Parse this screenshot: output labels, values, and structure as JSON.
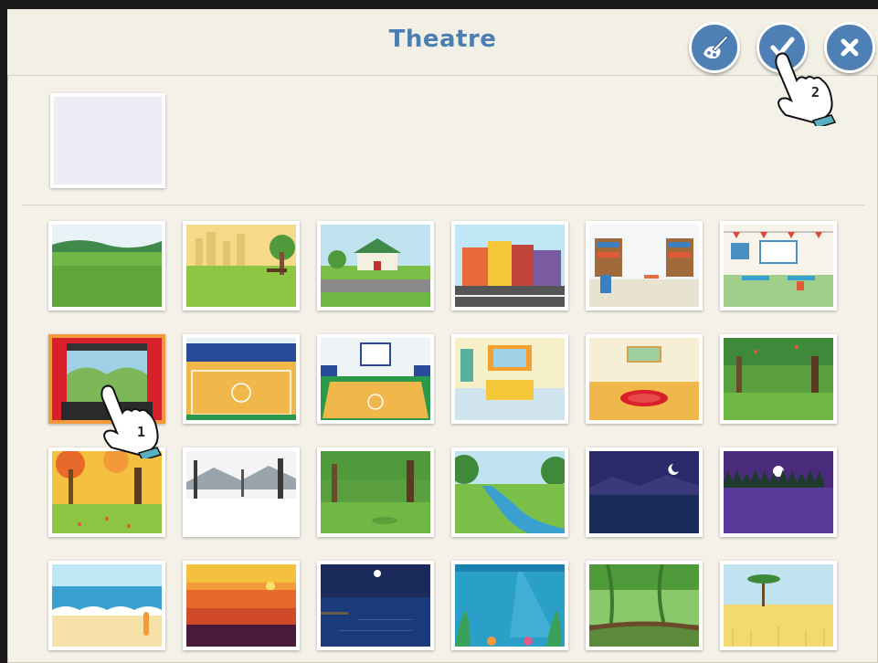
{
  "header": {
    "title": "Theatre",
    "buttons": [
      {
        "name": "paint-button",
        "icon": "paintbrush-icon"
      },
      {
        "name": "confirm-button",
        "icon": "checkmark-icon"
      },
      {
        "name": "close-button",
        "icon": "close-icon"
      }
    ]
  },
  "colors": {
    "accent": "#4f80b5",
    "selected_border": "#f29a3a",
    "background": "#f4f1e8"
  },
  "selected_slot": {
    "state": "empty"
  },
  "library": {
    "items": [
      "meadow",
      "city-park",
      "suburb",
      "city-street",
      "library",
      "classroom",
      "theatre",
      "gym",
      "basketball-court",
      "bedroom",
      "empty-room",
      "orchard",
      "autumn-forest",
      "winter-forest",
      "forest",
      "river",
      "night-lake",
      "night-forest",
      "beach",
      "sunset-sea",
      "night-pier",
      "underwater",
      "jungle",
      "savanna"
    ],
    "selected_index": 6
  },
  "hints": [
    {
      "step": "1",
      "target": "theatre"
    },
    {
      "step": "2",
      "target": "confirm-button"
    }
  ]
}
